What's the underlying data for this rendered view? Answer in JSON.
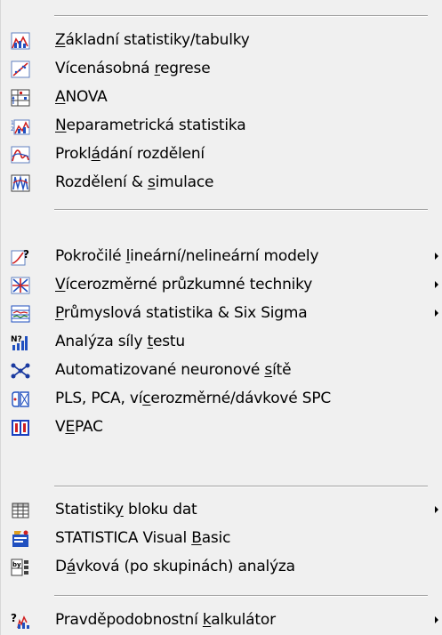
{
  "menu": {
    "items": [
      {
        "pre": "",
        "acc": "Z",
        "post": "ákladní statistiky/tabulky",
        "icon": "basic-statistics-icon",
        "submenu": false
      },
      {
        "pre": "Vícenásobná ",
        "acc": "r",
        "post": "egrese",
        "icon": "multiple-regression-icon",
        "submenu": false
      },
      {
        "pre": "",
        "acc": "A",
        "post": "NOVA",
        "icon": "anova-icon",
        "submenu": false
      },
      {
        "pre": "",
        "acc": "N",
        "post": "eparametrická statistika",
        "icon": "nonparametric-icon",
        "submenu": false
      },
      {
        "pre": "Prokl",
        "acc": "á",
        "post": "dání rozdělení",
        "icon": "distribution-fitting-icon",
        "submenu": false
      },
      {
        "pre": "Rozdělení & ",
        "acc": "s",
        "post": "imulace",
        "icon": "distribution-simulation-icon",
        "submenu": false
      },
      {
        "pre": "Pokročilé ",
        "acc": "l",
        "post": "ineární/nelineární modely",
        "icon": "advanced-models-icon",
        "submenu": true
      },
      {
        "pre": "",
        "acc": "V",
        "post": "ícerozměrné průzkumné techniky",
        "icon": "multivariate-exploratory-icon",
        "submenu": true
      },
      {
        "pre": "",
        "acc": "P",
        "post": "růmyslová statistika & Six Sigma",
        "icon": "industrial-statistics-icon",
        "submenu": true
      },
      {
        "pre": "Analýza síly ",
        "acc": "t",
        "post": "estu",
        "icon": "power-analysis-icon",
        "submenu": false
      },
      {
        "pre": "Automatizované neuronové ",
        "acc": "s",
        "post": "ítě",
        "icon": "neural-networks-icon",
        "submenu": false
      },
      {
        "pre": "PLS, PCA, ví",
        "acc": "c",
        "post": "erozměrné/dávkové SPC",
        "icon": "pls-pca-icon",
        "submenu": false
      },
      {
        "pre": "V",
        "acc": "E",
        "post": "PAC",
        "icon": "vepac-icon",
        "submenu": false
      },
      {
        "pre": "Statistik",
        "acc": "y",
        "post": " bloku dat",
        "icon": "block-stats-icon",
        "submenu": true
      },
      {
        "pre": "STATISTICA Visual ",
        "acc": "B",
        "post": "asic",
        "icon": "visual-basic-icon",
        "submenu": false
      },
      {
        "pre": "D",
        "acc": "á",
        "post": "vková (po skupinách) analýza",
        "icon": "by-group-icon",
        "submenu": false
      },
      {
        "pre": "Pravděpodobnostní ",
        "acc": "k",
        "post": "alkulátor",
        "icon": "probability-calculator-icon",
        "submenu": true
      }
    ]
  },
  "colors": {
    "menu_bg": "#f0f0f0",
    "text": "#000000",
    "separator": "#a0a0a0",
    "icon_blue": "#1a40c0",
    "icon_red": "#d02020"
  }
}
